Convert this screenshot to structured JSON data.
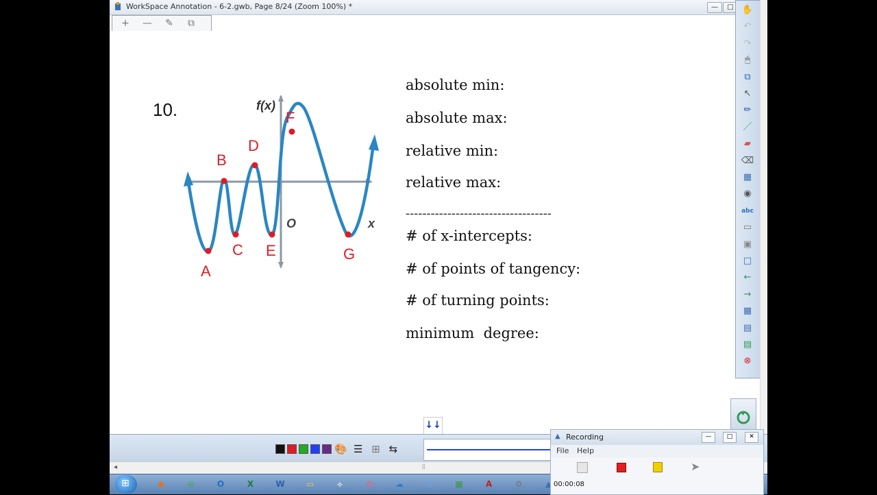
{
  "window": {
    "title": "WorkSpace Annotation - 6-2.gwb, Page 8/24  (Zoom 100%) *",
    "min_label": "—",
    "max_label": "□"
  },
  "edit_toolbar": {
    "icons": [
      "plus-icon",
      "minus-icon",
      "pen-edit-icon",
      "layers-icon"
    ],
    "glyphs": [
      "+",
      "—",
      "✎",
      "⧉"
    ]
  },
  "worksheet": {
    "question_number": "10.",
    "graph_labels": {
      "fx": "f(x)",
      "origin": "O",
      "x": "x",
      "points": [
        "A",
        "B",
        "C",
        "D",
        "E",
        "F",
        "G"
      ]
    },
    "lines": [
      "absolute min:",
      "absolute max:",
      "relative min:",
      "relative max:",
      "-----------------------------------",
      "# of x-intercepts:",
      "# of points of tangency:",
      "# of turning points:",
      "minimum  degree:"
    ]
  },
  "right_toolbar": {
    "icons": [
      "hand-icon",
      "undo-icon",
      "redo-icon",
      "mouse-icon",
      "copy-page-icon",
      "select-arrow-icon",
      "pen-icon",
      "green-pen-icon",
      "highlighter-icon",
      "eraser-icon",
      "ruler-icon",
      "camera-icon",
      "text-abc-icon",
      "screen-shade-icon",
      "spotlight-icon",
      "new-page-icon",
      "previous-page-icon",
      "next-page-icon",
      "table-icon",
      "save-icon",
      "print-icon",
      "close-icon"
    ],
    "glyphs": [
      "✋",
      "↶",
      "↷",
      "🖱",
      "⧉",
      "↖",
      "✏",
      "／",
      "▰",
      "⌫",
      "▦",
      "◉",
      "abc",
      "▭",
      "▣",
      "□",
      "←",
      "→",
      "▦",
      "▤",
      "▤",
      "⊗"
    ]
  },
  "bottom_toolbar": {
    "colors": [
      "#111111",
      "#e01b24",
      "#22aa22",
      "#1f3fff",
      "#6a2a8a"
    ],
    "page_arrows": "↓↓"
  },
  "recording": {
    "title": "Recording",
    "menu": [
      "File",
      "Help"
    ],
    "elapsed": "00:00:08",
    "min_label": "—",
    "max_label": "□",
    "close_label": "✕"
  },
  "taskbar": {
    "apps": [
      "firefox-icon",
      "chrome-icon",
      "outlook-icon",
      "excel-icon",
      "word-icon",
      "folder-icon",
      "network-icon",
      "paint-icon",
      "onedrive-icon",
      "itunes-icon",
      "green-app-icon",
      "acrobat-icon",
      "tools-icon",
      "workspace-icon"
    ],
    "glyphs": [
      "◉",
      "◎",
      "O",
      "X",
      "W",
      "▭",
      "⟡",
      "✿",
      "☁",
      "♫",
      "▦",
      "A",
      "⚙",
      "▲"
    ]
  }
}
